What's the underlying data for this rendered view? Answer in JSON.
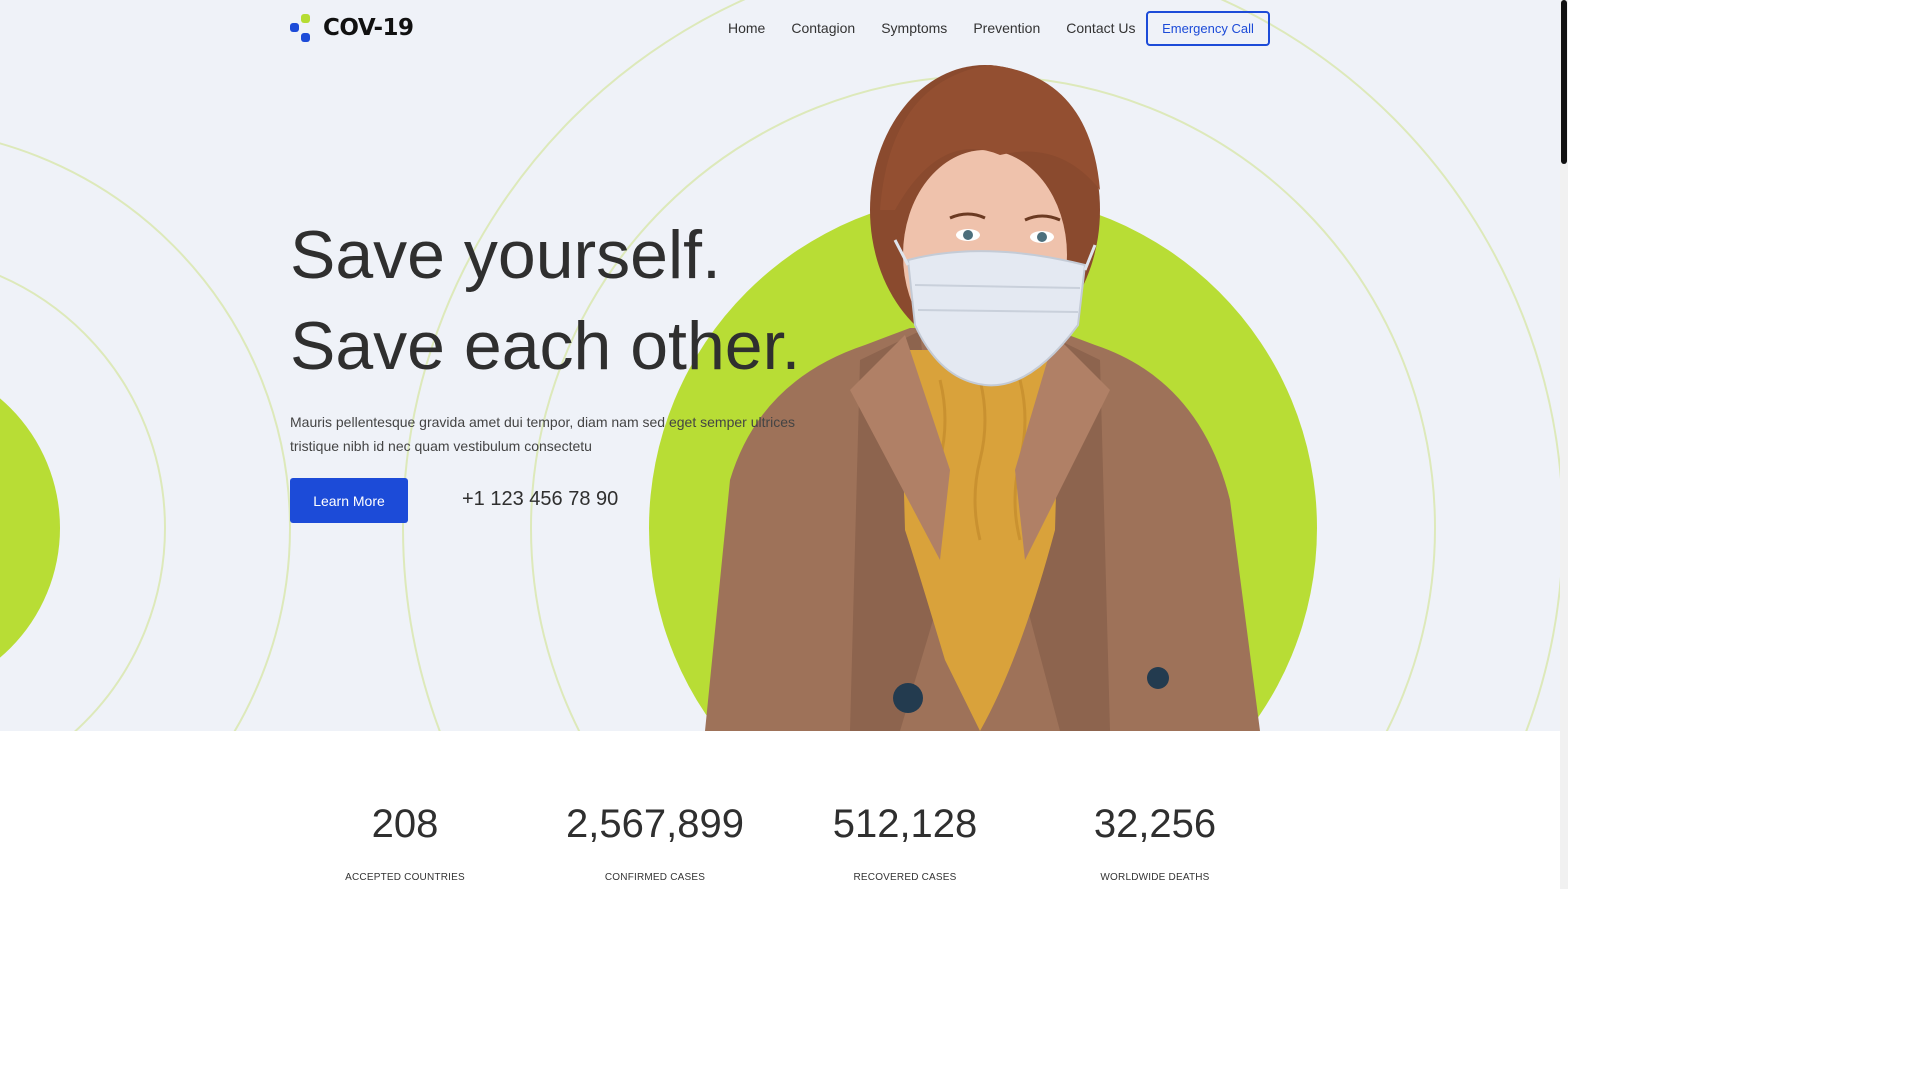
{
  "brand": {
    "name": "COV-19",
    "accent_green": "#b5dc33",
    "accent_blue": "#1c4bd8"
  },
  "nav": {
    "items": [
      "Home",
      "Contagion",
      "Symptoms",
      "Prevention",
      "Contact Us"
    ],
    "cta_label": "Emergency Call"
  },
  "hero": {
    "headline_line1": "Save yourself.",
    "headline_line2": "Save each other.",
    "lead": "Mauris pellentesque gravida amet dui tempor, diam nam sed eget semper ultrices tristique nibh id nec quam vestibulum consectetu",
    "button_label": "Learn More",
    "phone": "+1 123 456 78 90",
    "image_subject": "woman wearing a face mask, brown coat, yellow sweater"
  },
  "stats": [
    {
      "value": "208",
      "label": "ACCEPTED COUNTRIES"
    },
    {
      "value": "2,567,899",
      "label": "CONFIRMED CASES"
    },
    {
      "value": "512,128",
      "label": "RECOVERED CASES"
    },
    {
      "value": "32,256",
      "label": "WORLDWIDE DEATHS"
    }
  ]
}
